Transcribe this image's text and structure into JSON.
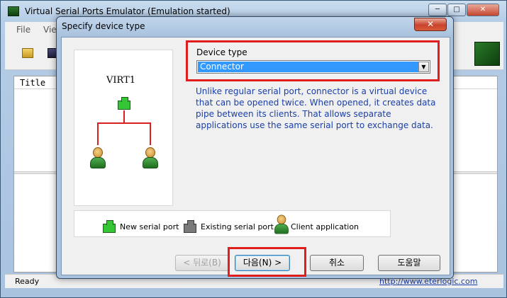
{
  "app": {
    "title": "Virtual Serial Ports Emulator (Emulation started)",
    "window_controls": {
      "minimize": "─",
      "maximize": "□",
      "close": "✕"
    },
    "menu": [
      {
        "label": "File"
      },
      {
        "label": "Vie"
      }
    ],
    "list_header_title": "Title",
    "status_text": "Ready",
    "status_link": "http://www.eterlogic.com"
  },
  "dialog": {
    "title": "Specify device type",
    "close_glyph": "✕",
    "preview_label": "VIRT1",
    "legend": [
      {
        "label": "New serial port"
      },
      {
        "label": "Existing serial port"
      },
      {
        "label": "Client application"
      }
    ],
    "device_type_label": "Device type",
    "device_type_value": "Connector",
    "description": "Unlike regular serial port, connector is a virtual device that can be opened twice. When opened, it creates data pipe between its clients. That allows separate applications use the same serial port to exchange data.",
    "buttons": {
      "back": "< 뒤로(B)",
      "next": "다음(N) >",
      "cancel": "취소",
      "help": "도움말"
    }
  },
  "colors": {
    "highlight": "#e01e1e",
    "selection": "#3399ff",
    "description_text": "#1a3fa8",
    "connector_line": "#d72020",
    "new_port": "#34c634",
    "existing_port": "#7a7a7a"
  }
}
